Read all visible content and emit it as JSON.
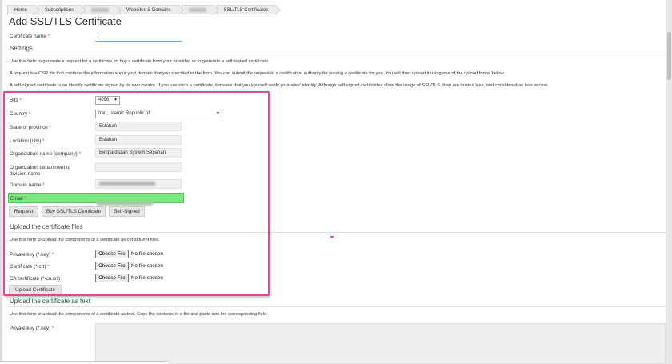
{
  "breadcrumb": {
    "home": "Home",
    "subscriptions": "Subscriptions",
    "websites_domains": "Websites & Domains",
    "ssl": "SSL/TLS Certificates"
  },
  "page_title": "Add SSL/TLS Certificate",
  "cert_name": {
    "label": "Certificate name",
    "required": "*",
    "value": ""
  },
  "settings": {
    "heading": "Settings",
    "para1": "Use this form to generate a request for a certificate, to buy a certificate from your provider, or to generate a self-signed certificate.",
    "para2": "A request is a CSR file that contains the information about your domain that you specified in the form. You can submit the request to a certification authority for issuing a certificate for you. You will then upload it using one of the upload forms below.",
    "para3": "A self-signed certificate is an identity certificate signed by its own creator. If you use such a certificate, it means that you yourself verify your sites' identity. Although self-signed certificates allow the usage of SSL/TLS, they are trusted less, and considered as less secure."
  },
  "form": {
    "bits": {
      "label": "Bits",
      "value": "4096"
    },
    "country": {
      "label": "Country",
      "value": "Iran, Islamic Republic of"
    },
    "state": {
      "label": "State or province",
      "value": "Esfahan"
    },
    "location": {
      "label": "Location (city)",
      "value": "Esfahan"
    },
    "org": {
      "label": "Organization name (company)",
      "value": "Behpardazan System Sepahan"
    },
    "dept": {
      "label_line1": "Organization department or",
      "label_line2": "division name",
      "value": ""
    },
    "domain": {
      "label": "Domain name"
    },
    "email": {
      "label": "Email"
    },
    "required_mark": "*"
  },
  "buttons": {
    "request": "Request",
    "buy": "Buy SSL/TLS Certificate",
    "self_signed": "Self-Signed"
  },
  "upload_files": {
    "heading": "Upload the certificate files",
    "description": "Use this form to upload the components of a certificate as constituent files.",
    "private_key_label": "Private key (*.key)",
    "certificate_label": "Certificate (*.crt)",
    "ca_label": "CA certificate (*-ca.crt)",
    "choose_file": "Choose File",
    "no_file": "No file chosen",
    "upload_button": "Upload Certificate"
  },
  "upload_text": {
    "heading": "Upload the certificate as text",
    "description": "Use this form to upload the components of a certificate as text. Copy the contents of a file and paste into the corresponding field.",
    "private_key_label": "Private key (*.key)"
  },
  "colors": {
    "highlight_border": "#e0488f",
    "email_highlight": "#7ee67e",
    "required": "#d43f3f"
  }
}
